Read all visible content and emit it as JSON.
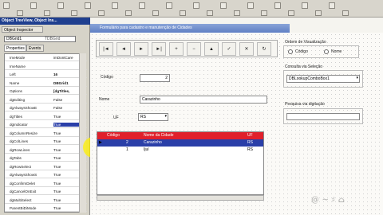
{
  "toolbar": {
    "buttons": 26
  },
  "left_panel": {
    "title": "Object TreeView, Object Ins...",
    "inspector_label": "Object Inspector",
    "component": "DBGrid1",
    "component_type": "TDBGrid",
    "tabs": [
      "Properties",
      "Events"
    ],
    "properties": [
      {
        "name": "ImeMode",
        "value": "imDontCare"
      },
      {
        "name": "ImeName",
        "value": ""
      },
      {
        "name": "Left",
        "value": "16"
      },
      {
        "name": "Name",
        "value": "DBGrid1"
      },
      {
        "name": "Options",
        "value": "[dgTitles,"
      },
      {
        "name": "dgEditing",
        "value": "False"
      },
      {
        "name": "dgAlwaysShowE",
        "value": "False"
      },
      {
        "name": "dgTitles",
        "value": "True"
      },
      {
        "name": "dgIndicator",
        "value": "True"
      },
      {
        "name": "dgColumnResize",
        "value": "True"
      },
      {
        "name": "dgColLines",
        "value": "True"
      },
      {
        "name": "dgRowLines",
        "value": "True"
      },
      {
        "name": "dgTabs",
        "value": "True"
      },
      {
        "name": "dgRowSelect",
        "value": "True"
      },
      {
        "name": "dgAlwaysShowS",
        "value": "True"
      },
      {
        "name": "dgConfirmDelet",
        "value": "True"
      },
      {
        "name": "dgCancelOnExit",
        "value": "True"
      },
      {
        "name": "dgMultiSelect",
        "value": "True"
      },
      {
        "name": "ParentBiDiMode",
        "value": "True"
      }
    ]
  },
  "form": {
    "title": "Formulário para cadastro e manutenção de Cidades",
    "nav_buttons": [
      "|◄",
      "◄",
      "►",
      "►|",
      "+",
      "−",
      "▲",
      "✓",
      "✕",
      "↻"
    ],
    "labels": {
      "codigo": "Código",
      "nome": "Nome",
      "uf": "UF",
      "ordem": "Ordem de Visualização",
      "consulta": "Consulta via Seleção",
      "pesquisa": "Pesquisa via digitação"
    },
    "fields": {
      "codigo": "2",
      "nome": "Carazinho",
      "uf": "RS",
      "lookup": "DBLookupComboBox1"
    },
    "radios": [
      "Código",
      "Nome"
    ],
    "grid": {
      "headers": [
        "Código",
        "Nome da Cidade",
        "UF"
      ],
      "rows": [
        [
          "2",
          "Carazinho",
          "RS"
        ],
        [
          "1",
          "Ijuí",
          "RS"
        ]
      ]
    }
  }
}
